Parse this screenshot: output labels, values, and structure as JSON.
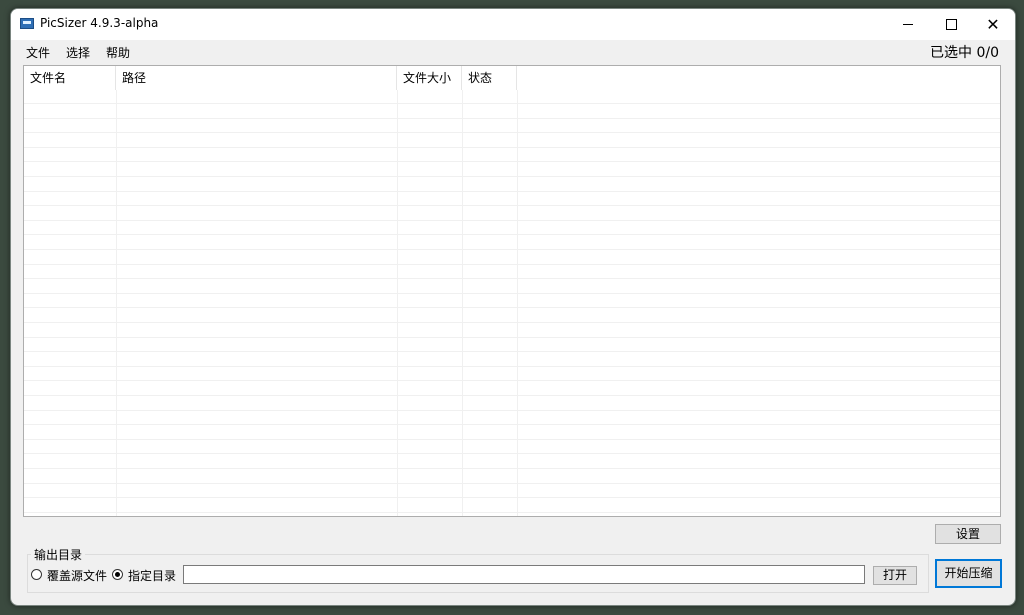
{
  "window": {
    "title": "PicSizer 4.9.3-alpha",
    "app_icon": "picture-icon"
  },
  "menubar": {
    "items": [
      "文件",
      "选择",
      "帮助"
    ],
    "selected_count": "已选中 0/0"
  },
  "file_list": {
    "columns": [
      "文件名",
      "路径",
      "文件大小",
      "状态"
    ],
    "rows": []
  },
  "buttons": {
    "settings": "设置",
    "start": "开始压缩",
    "open": "打开"
  },
  "output": {
    "group_label": "输出目录",
    "options": [
      {
        "label": "覆盖源文件",
        "checked": false
      },
      {
        "label": "指定目录",
        "checked": true
      }
    ],
    "directory_value": "",
    "directory_placeholder": ""
  },
  "colors": {
    "accent": "#0078d7",
    "window_bg": "#f0f0f0"
  }
}
